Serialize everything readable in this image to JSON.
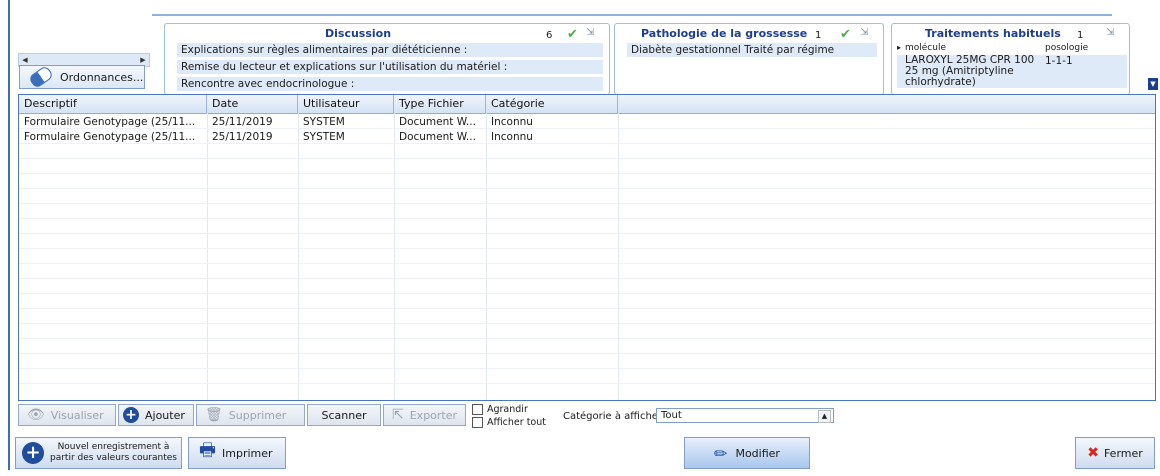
{
  "left": {
    "ordonnances_label": "Ordonnances..."
  },
  "discussion": {
    "title": "Discussion",
    "count": "6",
    "lines": [
      "Explications sur règles alimentaires par diététicienne :",
      "Remise du lecteur et explications sur l'utilisation du matériel :",
      "Rencontre avec endocrinologue :"
    ]
  },
  "pathologie": {
    "title": "Pathologie de la grossesse",
    "count": "1",
    "lines": [
      "Diabète gestationnel Traité par régime"
    ]
  },
  "traitements": {
    "title": "Traitements habituels",
    "count": "1",
    "headers": {
      "molecule": "molécule",
      "posologie": "posologie"
    },
    "row": {
      "molecule": "LAROXYL 25MG CPR 100 25 mg (Amitriptyline chlorhydrate)",
      "posologie": "1-1-1"
    }
  },
  "grid": {
    "columns": [
      "Descriptif",
      "Date",
      "Utilisateur",
      "Type Fichier",
      "Catégorie"
    ],
    "rows": [
      [
        "Formulaire Genotypage (25/11...",
        "25/11/2019",
        "SYSTEM",
        "Document W...",
        "Inconnu"
      ],
      [
        "Formulaire Genotypage (25/11...",
        "25/11/2019",
        "SYSTEM",
        "Document W...",
        "Inconnu"
      ]
    ]
  },
  "toolbar": {
    "visualiser": "Visualiser",
    "ajouter": "Ajouter",
    "supprimer": "Supprimer",
    "scanner": "Scanner",
    "exporter": "Exporter",
    "agrandir": "Agrandir",
    "afficher_tout": "Afficher tout",
    "categorie_label": "Catégorie à afficher:",
    "categorie_value": "Tout"
  },
  "bottom": {
    "nouvel_line1": "Nouvel enregistrement à",
    "nouvel_line2": "partir des valeurs courantes",
    "imprimer": "Imprimer",
    "modifier": "Modifier",
    "fermer": "Fermer"
  },
  "colors": {
    "accent": "#1d3d8f",
    "border": "#4a76c0",
    "row_highlight": "#dfeaf8",
    "check_green": "#4bb04b",
    "close_red": "#d9261c"
  }
}
